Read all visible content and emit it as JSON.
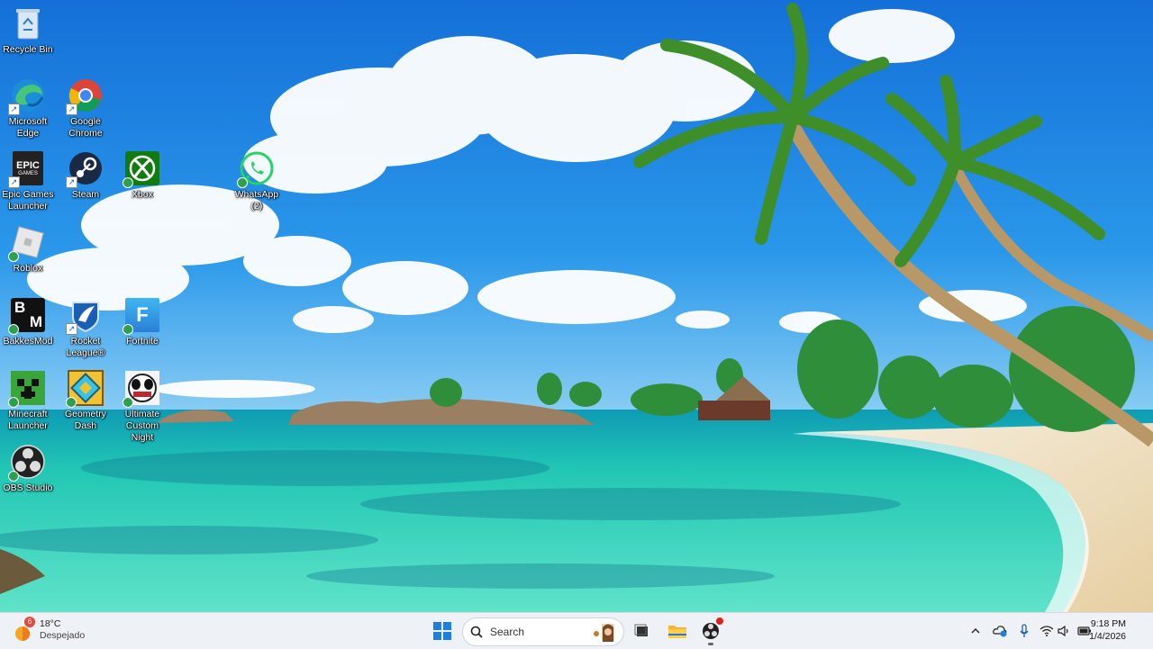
{
  "desktop": {
    "icons": [
      {
        "label": "Recycle Bin"
      },
      {
        "label": "Microsoft\nEdge"
      },
      {
        "label": "Google\nChrome"
      },
      {
        "label": "Epic Games\nLauncher"
      },
      {
        "label": "Steam"
      },
      {
        "label": "Xbox"
      },
      {
        "label": "WhatsApp (2)"
      },
      {
        "label": "Roblox"
      },
      {
        "label": "BakkesMod"
      },
      {
        "label": "Rocket\nLeague®"
      },
      {
        "label": "Fortnite"
      },
      {
        "label": "Minecraft\nLauncher"
      },
      {
        "label": "Geometry\nDash"
      },
      {
        "label": "Ultimate\nCustom Night"
      },
      {
        "label": "OBS Studio"
      }
    ],
    "icon_glyph_text": {
      "epic": "EPIC",
      "epic_sub": "GAMES",
      "fortnite": "F",
      "bakkes_b": "B",
      "bakkes_m": "M"
    }
  },
  "taskbar": {
    "weather": {
      "badge": "6",
      "temp": "18°C",
      "condition": "Despejado"
    },
    "search_placeholder": "Search",
    "clock": {
      "time": "9:18 PM",
      "date": "1/4/2026"
    }
  },
  "colors": {
    "taskbar_bg": "#eef1f6",
    "sky": "#1e8fe0",
    "sea": "#2ed3b0",
    "sand": "#f3e7cf"
  }
}
